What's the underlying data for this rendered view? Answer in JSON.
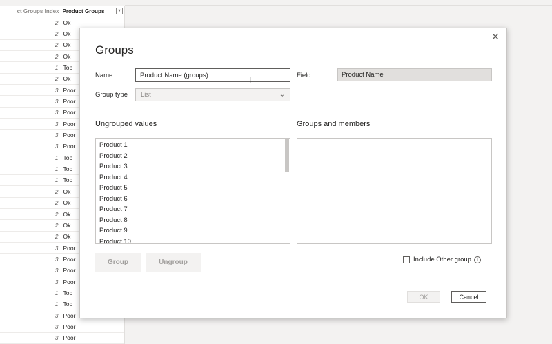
{
  "table": {
    "header_index": "ct Groups Index",
    "header_groups": "Product Groups",
    "filter_glyph": "▾",
    "rows": [
      {
        "index": "2",
        "group": "Ok"
      },
      {
        "index": "2",
        "group": "Ok"
      },
      {
        "index": "2",
        "group": "Ok"
      },
      {
        "index": "2",
        "group": "Ok"
      },
      {
        "index": "1",
        "group": "Top"
      },
      {
        "index": "2",
        "group": "Ok"
      },
      {
        "index": "3",
        "group": "Poor"
      },
      {
        "index": "3",
        "group": "Poor"
      },
      {
        "index": "3",
        "group": "Poor"
      },
      {
        "index": "3",
        "group": "Poor"
      },
      {
        "index": "3",
        "group": "Poor"
      },
      {
        "index": "3",
        "group": "Poor"
      },
      {
        "index": "1",
        "group": "Top"
      },
      {
        "index": "1",
        "group": "Top"
      },
      {
        "index": "1",
        "group": "Top"
      },
      {
        "index": "2",
        "group": "Ok"
      },
      {
        "index": "2",
        "group": "Ok"
      },
      {
        "index": "2",
        "group": "Ok"
      },
      {
        "index": "2",
        "group": "Ok"
      },
      {
        "index": "2",
        "group": "Ok"
      },
      {
        "index": "3",
        "group": "Poor"
      },
      {
        "index": "3",
        "group": "Poor"
      },
      {
        "index": "3",
        "group": "Poor"
      },
      {
        "index": "3",
        "group": "Poor"
      },
      {
        "index": "1",
        "group": "Top"
      },
      {
        "index": "1",
        "group": "Top"
      },
      {
        "index": "3",
        "group": "Poor"
      },
      {
        "index": "3",
        "group": "Poor"
      },
      {
        "index": "3",
        "group": "Poor"
      }
    ]
  },
  "dialog": {
    "title": "Groups",
    "close_glyph": "✕",
    "name_label": "Name",
    "name_value": "Product Name (groups)",
    "field_label": "Field",
    "field_value": "Product Name",
    "group_type_label": "Group type",
    "group_type_value": "List",
    "ungrouped_title": "Ungrouped values",
    "groups_members_title": "Groups and members",
    "ungrouped_items": [
      "Product 1",
      "Product 2",
      "Product 3",
      "Product 4",
      "Product 5",
      "Product 6",
      "Product 7",
      "Product 8",
      "Product 9",
      "Product 10"
    ],
    "group_button": "Group",
    "ungroup_button": "Ungroup",
    "include_other_label": "Include Other group",
    "info_glyph": "i",
    "ok_button": "OK",
    "cancel_button": "Cancel"
  }
}
